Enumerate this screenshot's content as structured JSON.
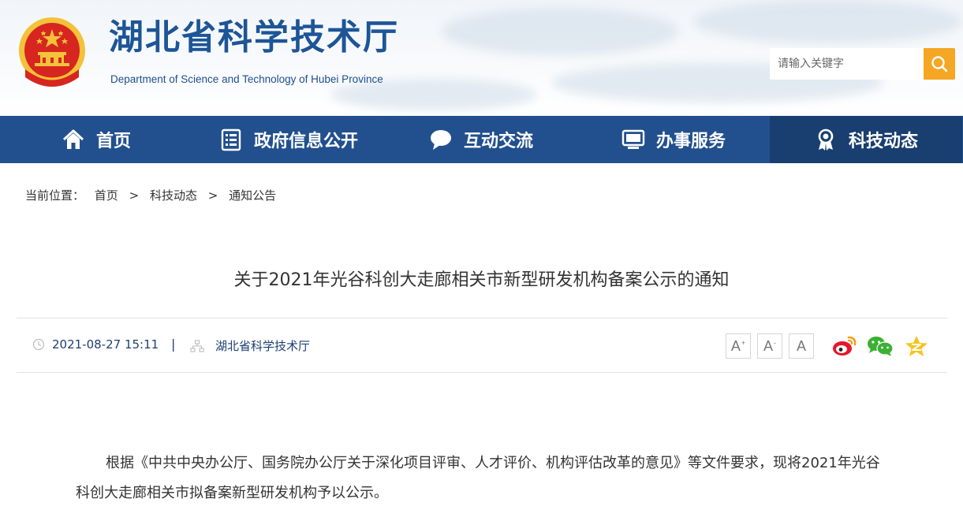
{
  "header": {
    "title": "湖北省科学技术厅",
    "subtitle": "Department of Science and Technology of Hubei Province",
    "search_placeholder": "请输入关键字",
    "search_icon": "search-icon"
  },
  "nav": {
    "items": [
      {
        "label": "首页",
        "icon": "home-icon"
      },
      {
        "label": "政府信息公开",
        "icon": "document-icon"
      },
      {
        "label": "互动交流",
        "icon": "chat-bubble-icon"
      },
      {
        "label": "办事服务",
        "icon": "monitor-icon"
      },
      {
        "label": "科技动态",
        "icon": "award-icon"
      }
    ],
    "active_index": 4
  },
  "breadcrumb": {
    "prefix": "当前位置：",
    "items": [
      "首页",
      "科技动态",
      "通知公告"
    ],
    "separator": ">"
  },
  "article": {
    "title": "关于2021年光谷科创大走廊相关市新型研发机构备案公示的通知",
    "date": "2021-08-27 15:11",
    "meta_separator": "|",
    "source": "湖北省科学技术厅",
    "font_sizes": [
      {
        "label": "A",
        "mark": "+"
      },
      {
        "label": "A",
        "mark": "-"
      },
      {
        "label": "A",
        "mark": ""
      }
    ],
    "share_icons": [
      "weibo-icon",
      "wechat-icon",
      "qzone-icon"
    ],
    "body": "根据《中共中央办公厅、国务院办公厅关于深化项目评审、人才评价、机构评估改革的意见》等文件要求，现将2021年光谷科创大走廊相关市拟备案新型研发机构予以公示。"
  },
  "colors": {
    "brand_blue": "#22508e",
    "nav_active": "#193e70",
    "search_button": "#f5a623",
    "title_blue": "#1d5597",
    "emblem_red": "#d7261f",
    "emblem_gold": "#f3c23a"
  }
}
